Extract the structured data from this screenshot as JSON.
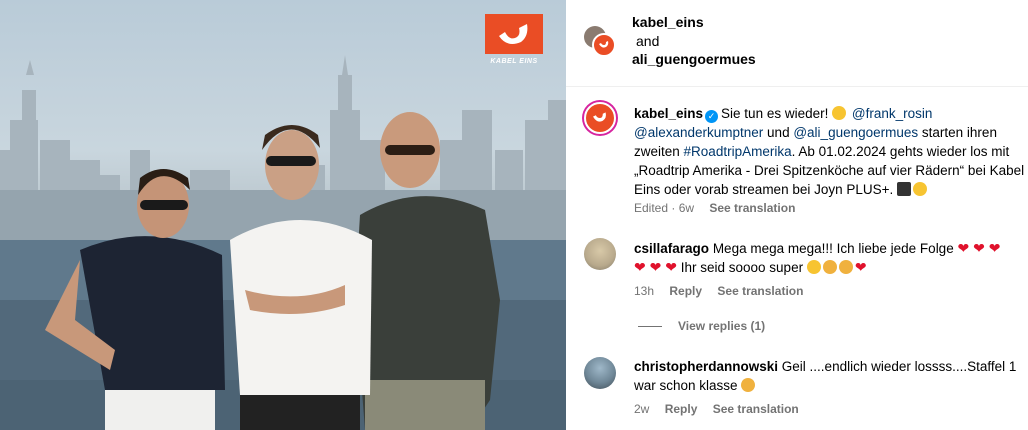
{
  "post_image": {
    "logo_text": "KABEL EINS",
    "brand_color": "#ea4d25"
  },
  "header": {
    "account_1": "kabel_eins",
    "connector": "and",
    "account_2": "ali_guengoermues"
  },
  "caption": {
    "author": "kabel_eins",
    "text_1": "Sie tun es wieder!",
    "mention_1": "@frank_rosin",
    "mention_2": "@alexanderkumptner",
    "text_2": "und",
    "mention_3": "@ali_guengoermues",
    "text_3": "starten ihren zweiten",
    "hashtag": "#RoadtripAmerika",
    "text_4": ". Ab 01.02.2024 gehts wieder los mit „Roadtrip Amerika - Drei Spitzenköche auf vier Rädern“ bei Kabel Eins oder vorab streamen bei Joyn PLUS+.",
    "edited": "Edited · 6w",
    "see_translation": "See translation"
  },
  "comments": [
    {
      "user": "csillafarago",
      "text_1": "Mega mega mega!!! Ich liebe jede Folge",
      "text_2": "Ihr seid soooo super",
      "age": "13h",
      "reply": "Reply",
      "see_translation": "See translation",
      "view_replies": "View replies (1)"
    },
    {
      "user": "christopherdannowski",
      "text": "Geil ....endlich wieder lossss....Staffel 1 war schon klasse",
      "age": "2w",
      "reply": "Reply",
      "see_translation": "See translation"
    }
  ],
  "colors": {
    "link": "#00376b",
    "muted": "#737373",
    "verified": "#0095f6",
    "heart": "#e0122c"
  }
}
